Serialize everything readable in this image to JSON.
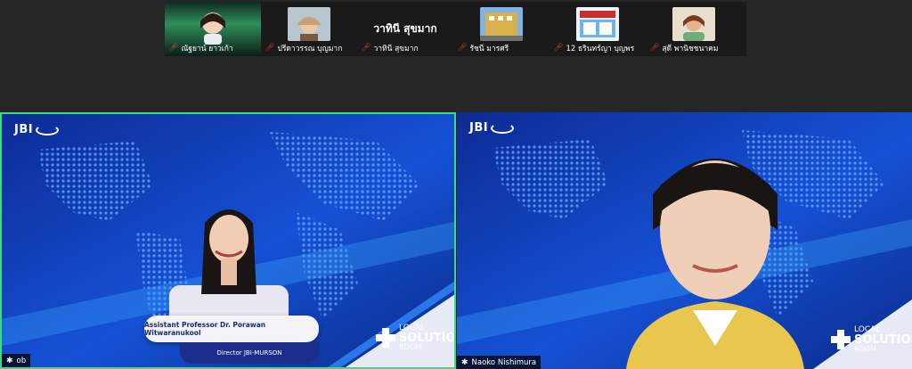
{
  "participants": [
    {
      "name": "ณัฐยาน์ ยาวเก้า",
      "muted": true
    },
    {
      "name": "ปรีดาวรรณ บุญมาก",
      "muted": true
    },
    {
      "name": "วาทินี สุขมาก",
      "muted": true
    },
    {
      "name": "รัชนี มารศรี",
      "muted": true
    },
    {
      "name": "12 ธรินทร์ญา บุญพร",
      "muted": true
    },
    {
      "name": "สุดี พานิชชนาคม",
      "muted": true
    }
  ],
  "strip_center_name": "วาทินี สุขมาก",
  "tile_left": {
    "brand": "JBI",
    "lower_third_name": "Assistant Professor Dr. Porawan Witwaranukool",
    "lower_third_role": "Director JBI-MURSON",
    "logo_line1": "LOCAL",
    "logo_line2": "SOLUTION",
    "logo_line3": "ROOM",
    "participant_label": "ob"
  },
  "tile_right": {
    "brand": "JBI",
    "logo_line1": "LOCAL",
    "logo_line2": "SOLUTION",
    "logo_line3": "ROOM",
    "participant_label": "Naoko Nishimura"
  },
  "colors": {
    "active_speaker_border": "#3ddc84",
    "mic_muted": "#e0393e",
    "news_blue": "#1646c8"
  }
}
